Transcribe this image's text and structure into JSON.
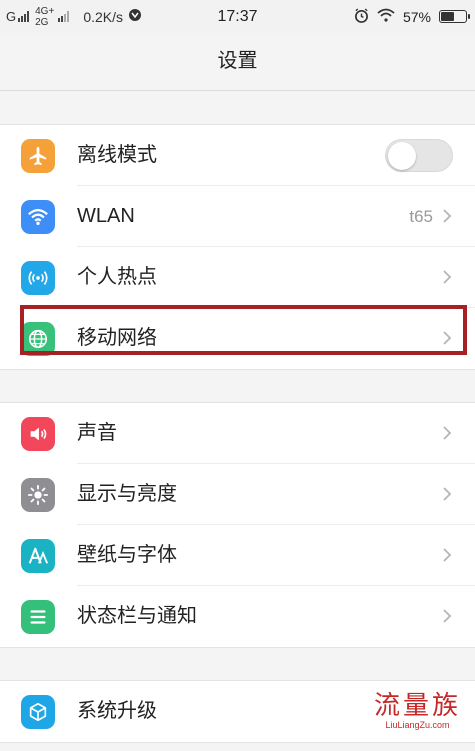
{
  "status_bar": {
    "carrier1": "G",
    "net_type_top": "4G+",
    "net_type_bottom": "2G",
    "speed": "0.2K/s",
    "time": "17:37",
    "battery": "57%",
    "battery_level": 0.57
  },
  "header": {
    "title": "设置"
  },
  "groups": [
    {
      "items": [
        {
          "label": "离线模式",
          "icon": "airplane-icon",
          "color": "#f5a13a"
        },
        {
          "label": "WLAN",
          "value": "t65",
          "icon": "wifi-icon",
          "color": "#3e8ef7"
        },
        {
          "label": "个人热点",
          "icon": "hotspot-icon",
          "color": "#22a7e8"
        },
        {
          "label": "移动网络",
          "icon": "globe-icon",
          "color": "#37c17a"
        }
      ]
    },
    {
      "items": [
        {
          "label": "声音",
          "icon": "speaker-icon",
          "color": "#f2475b"
        },
        {
          "label": "显示与亮度",
          "icon": "brightness-icon",
          "color": "#8e8e93"
        },
        {
          "label": "壁纸与字体",
          "icon": "font-icon",
          "color": "#19b3c4"
        },
        {
          "label": "状态栏与通知",
          "icon": "notification-icon",
          "color": "#34c07a"
        }
      ]
    },
    {
      "items": [
        {
          "label": "系统升级",
          "icon": "upgrade-icon",
          "color": "#1fa6e6"
        }
      ]
    }
  ],
  "watermark": {
    "main": "流量族",
    "sub": "LiuLiangZu.com"
  },
  "airplane_mode_on": false
}
